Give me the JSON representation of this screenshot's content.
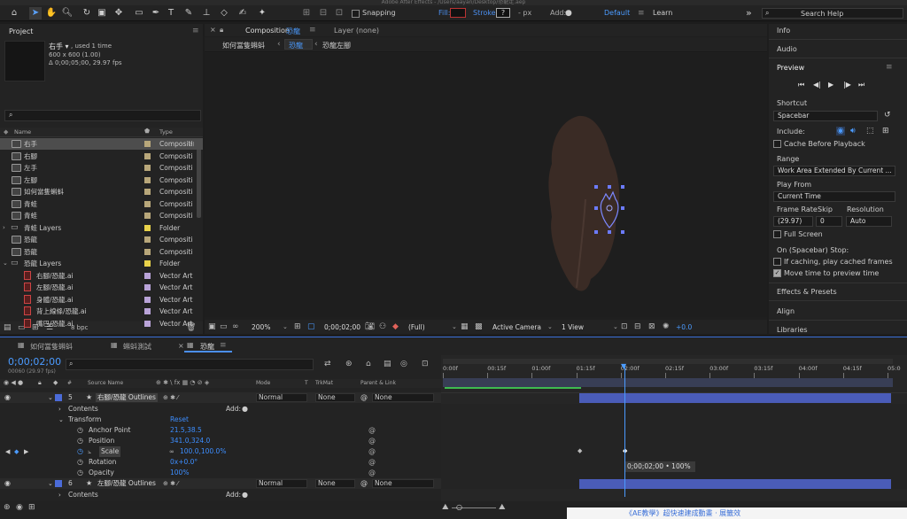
{
  "titlebar": "Adobe After Effects - /Users/aayan/Desktop/恐龍走.aep",
  "toolbar": {
    "snapping": "Snapping",
    "fill": "Fill:",
    "stroke": "Stroke:",
    "stroke_value": "?",
    "stroke_unit": "- px",
    "add": "Add:",
    "workspace_default": "Default",
    "workspace_learn": "Learn",
    "search_help": "Search Help"
  },
  "project": {
    "title": "Project",
    "selected_name": "右手 ▾",
    "used": ", used 1 time",
    "dims": "600 x 600 (1.00)",
    "duration": "Δ 0;00;05;00, 29.97 fps",
    "col_name": "Name",
    "col_type": "Type",
    "bpc": "8 bpc",
    "items": [
      {
        "name": "右手",
        "type": "Compositi",
        "color": "#b8a77a",
        "kind": "comp",
        "sel": true
      },
      {
        "name": "右腳",
        "type": "Compositi",
        "color": "#b8a77a",
        "kind": "comp"
      },
      {
        "name": "左手",
        "type": "Compositi",
        "color": "#b8a77a",
        "kind": "comp"
      },
      {
        "name": "左腳",
        "type": "Compositi",
        "color": "#b8a77a",
        "kind": "comp"
      },
      {
        "name": "如何當隻蝌蚪",
        "type": "Compositi",
        "color": "#b8a77a",
        "kind": "comp"
      },
      {
        "name": "青蛙",
        "type": "Compositi",
        "color": "#b8a77a",
        "kind": "comp"
      },
      {
        "name": "青蛙",
        "type": "Compositi",
        "color": "#b8a77a",
        "kind": "comp"
      },
      {
        "name": "青蛙 Layers",
        "type": "Folder",
        "color": "#e8d24a",
        "kind": "folder"
      },
      {
        "name": "恐龍",
        "type": "Compositi",
        "color": "#b8a77a",
        "kind": "comp"
      },
      {
        "name": "恐龍",
        "type": "Compositi",
        "color": "#b8a77a",
        "kind": "comp"
      },
      {
        "name": "恐龍 Layers",
        "type": "Folder",
        "color": "#e8d24a",
        "kind": "folder",
        "open": true
      },
      {
        "name": "右腳/恐龍.ai",
        "type": "Vector Art",
        "color": "#b9a3d8",
        "kind": "ai"
      },
      {
        "name": "左腳/恐龍.ai",
        "type": "Vector Art",
        "color": "#b9a3d8",
        "kind": "ai"
      },
      {
        "name": "身體/恐龍.ai",
        "type": "Vector Art",
        "color": "#b9a3d8",
        "kind": "ai"
      },
      {
        "name": "背上線條/恐龍.ai",
        "type": "Vector Art",
        "color": "#b9a3d8",
        "kind": "ai"
      },
      {
        "name": "嘴巴/恐龍.ai",
        "type": "Vector Art",
        "color": "#b9a3d8",
        "kind": "ai"
      }
    ]
  },
  "comp": {
    "tab": "Composition",
    "tab_name": "恐龍",
    "layer_tab": "Layer (none)",
    "bc": [
      "如何當隻蝌蚪",
      "恐龍",
      "恐龍左腳"
    ],
    "zoom": "200%",
    "timecode": "0;00;02;00",
    "resolution": "(Full)",
    "camera": "Active Camera",
    "views": "1 View",
    "exposure": "+0.0"
  },
  "right": {
    "info": "Info",
    "audio": "Audio",
    "preview": "Preview",
    "shortcut": "Shortcut",
    "shortcut_val": "Spacebar",
    "include": "Include:",
    "cache": "Cache Before Playback",
    "range": "Range",
    "range_val": "Work Area Extended By Current ...",
    "playfrom": "Play From",
    "playfrom_val": "Current Time",
    "framerate": "Frame Rate",
    "skip": "Skip",
    "resolution": "Resolution",
    "fr_val": "(29.97)",
    "skip_val": "0",
    "res_val": "Auto",
    "fullscreen": "Full Screen",
    "stop": "On (Spacebar) Stop:",
    "ifcaching": "If caching, play cached frames",
    "movetime": "Move time to preview time",
    "effects": "Effects & Presets",
    "align": "Align",
    "libraries": "Libraries"
  },
  "tl": {
    "tabs": [
      "如何當隻蝌蚪",
      "蝌蚪測試",
      "恐龍"
    ],
    "timecode": "0;00;02;00",
    "fps": "00060 (29.97 fps)",
    "cols": {
      "hash": "#",
      "source": "Source Name",
      "mode": "Mode",
      "t": "T",
      "trkmat": "TrkMat",
      "parent": "Parent & Link"
    },
    "ruler": [
      "0:00f",
      "00:15f",
      "01:00f",
      "01:15f",
      "02:00f",
      "02:15f",
      "03:00f",
      "03:15f",
      "04:00f",
      "04:15f",
      "05:0"
    ],
    "layer5": {
      "num": "5",
      "name": "右腳/恐龍 Outlines",
      "mode": "Normal",
      "trk": "None",
      "parent": "None"
    },
    "contents": "Contents",
    "add": "Add:",
    "transform": "Transform",
    "reset": "Reset",
    "props": [
      {
        "n": "Anchor Point",
        "v": "21.5,38.5"
      },
      {
        "n": "Position",
        "v": "341.0,324.0"
      },
      {
        "n": "Scale",
        "v": "100.0,100.0%"
      },
      {
        "n": "Rotation",
        "v": "0x+0.0°"
      },
      {
        "n": "Opacity",
        "v": "100%"
      }
    ],
    "layer6": {
      "num": "6",
      "name": "左腳/恐龍 Outlines",
      "mode": "Normal",
      "trk": "None",
      "parent": "None"
    },
    "contents2": "Contents",
    "tooltip": "0;00;02;00 • 100%",
    "footer": "《AE教學》超快速建成動畫 · 展籤效"
  }
}
